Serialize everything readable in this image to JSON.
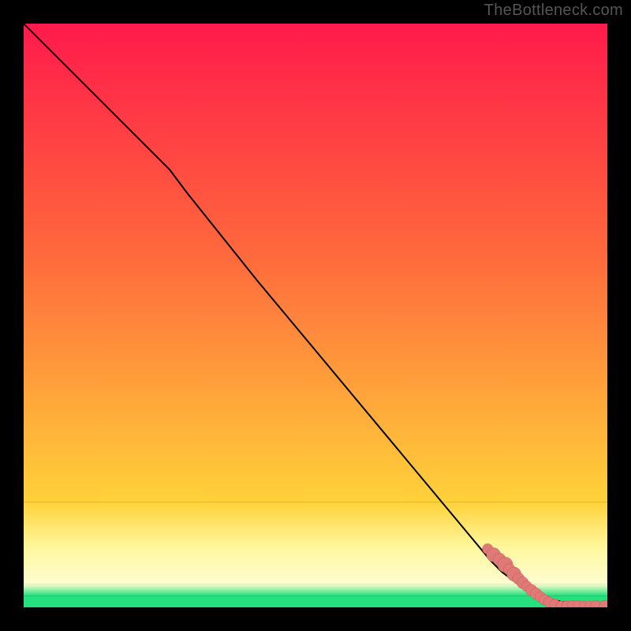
{
  "watermark": "TheBottleneck.com",
  "colors": {
    "page_bg": "#000000",
    "gradient_top": "#ff1a4b",
    "gradient_mid_upper": "#ff6a3c",
    "gradient_mid": "#ffd23a",
    "gradient_low": "#fff8a0",
    "gradient_pale": "#fdfdd0",
    "gradient_green": "#25e07e",
    "curve": "#000000",
    "marker_fill": "#e07a76",
    "marker_stroke": "#c85a56"
  },
  "chart_data": {
    "type": "line",
    "title": "",
    "xlabel": "",
    "ylabel": "",
    "xlim": [
      0,
      100
    ],
    "ylim": [
      0,
      100
    ],
    "series": [
      {
        "name": "curve",
        "x": [
          0,
          5,
          10,
          15,
          20,
          25,
          28,
          32,
          36,
          40,
          45,
          50,
          55,
          60,
          65,
          70,
          75,
          80,
          82,
          84,
          86,
          88,
          90,
          92,
          94,
          96,
          98,
          100
        ],
        "y": [
          100,
          95,
          90,
          85,
          80,
          75,
          71,
          66,
          61,
          56,
          50,
          44,
          38,
          32,
          26,
          20,
          14,
          8,
          6,
          4.5,
          3.2,
          2.2,
          1.5,
          1.0,
          0.6,
          0.35,
          0.15,
          0.05
        ]
      }
    ],
    "markers": [
      {
        "x": 79.5,
        "y": 10.0,
        "r": 0.9
      },
      {
        "x": 80.5,
        "y": 9.0,
        "r": 1.2
      },
      {
        "x": 81.5,
        "y": 8.2,
        "r": 1.1
      },
      {
        "x": 82.5,
        "y": 7.3,
        "r": 1.3
      },
      {
        "x": 83.2,
        "y": 6.5,
        "r": 1.0
      },
      {
        "x": 84.0,
        "y": 5.7,
        "r": 1.2
      },
      {
        "x": 84.8,
        "y": 4.9,
        "r": 1.0
      },
      {
        "x": 85.5,
        "y": 4.2,
        "r": 1.0
      },
      {
        "x": 86.2,
        "y": 3.6,
        "r": 0.9
      },
      {
        "x": 87.0,
        "y": 2.9,
        "r": 1.0
      },
      {
        "x": 87.8,
        "y": 2.3,
        "r": 1.0
      },
      {
        "x": 88.5,
        "y": 1.8,
        "r": 0.9
      },
      {
        "x": 89.2,
        "y": 1.3,
        "r": 0.9
      },
      {
        "x": 90.0,
        "y": 0.9,
        "r": 0.9
      },
      {
        "x": 91.0,
        "y": 0.5,
        "r": 0.9
      },
      {
        "x": 92.0,
        "y": 0.3,
        "r": 0.8
      },
      {
        "x": 93.0,
        "y": 0.3,
        "r": 0.8
      },
      {
        "x": 94.0,
        "y": 0.3,
        "r": 0.9
      },
      {
        "x": 95.0,
        "y": 0.3,
        "r": 0.9
      },
      {
        "x": 96.0,
        "y": 0.3,
        "r": 0.8
      },
      {
        "x": 97.0,
        "y": 0.3,
        "r": 0.8
      },
      {
        "x": 98.0,
        "y": 0.3,
        "r": 0.9
      },
      {
        "x": 99.5,
        "y": 0.3,
        "r": 0.9
      }
    ],
    "gradient_bands": [
      {
        "y0": 100,
        "y1": 60,
        "from": "gradient_top",
        "to": "gradient_mid_upper"
      },
      {
        "y0": 60,
        "y1": 18,
        "from": "gradient_mid_upper",
        "to": "gradient_mid"
      },
      {
        "y0": 18,
        "y1": 10,
        "from": "gradient_mid",
        "to": "gradient_low"
      },
      {
        "y0": 10,
        "y1": 4,
        "from": "gradient_low",
        "to": "gradient_pale"
      },
      {
        "y0": 4,
        "y1": 2,
        "from": "gradient_pale",
        "to": "gradient_green"
      },
      {
        "y0": 2,
        "y1": 0,
        "from": "gradient_green",
        "to": "gradient_green"
      }
    ]
  }
}
